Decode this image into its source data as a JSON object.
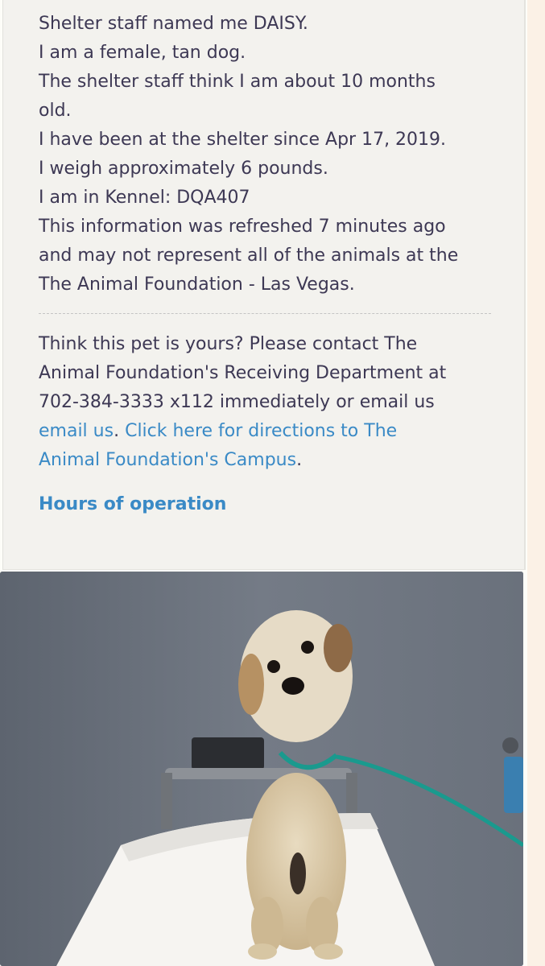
{
  "info": {
    "lines": [
      "Shelter staff named me DAISY.",
      "I am a female, tan dog.",
      "The shelter staff think I am about 10 months",
      "old.",
      "I have been at the shelter since Apr 17, 2019.",
      "I weigh approximately 6 pounds.",
      "I am in Kennel: DQA407",
      "This information was refreshed 7 minutes ago",
      "and may not represent all of the animals at the",
      "The Animal Foundation - Las Vegas."
    ]
  },
  "contact": {
    "line1": "Think this pet is yours? Please contact The",
    "line2": "Animal Foundation's Receiving Department at",
    "line3": "702-384-3333 x112 immediately or email us",
    "email_link": "email us",
    "sep1": ". ",
    "directions_link_1": "Click here for directions to The",
    "directions_link_2": "Animal Foundation's Campus",
    "end": "."
  },
  "hours_link": "Hours of operation",
  "photo": {
    "wall_color": "#6e7580",
    "dog_color": "#d8c6a4",
    "leash_color": "#1a9a8e",
    "pad_color": "#f6f4f1"
  }
}
